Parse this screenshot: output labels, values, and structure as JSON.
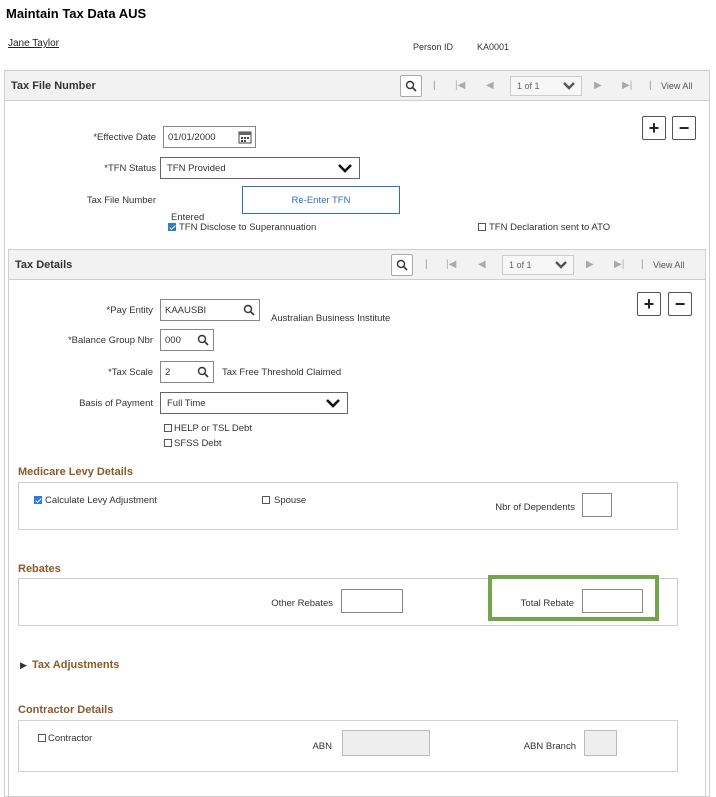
{
  "page": {
    "title": "Maintain Tax Data AUS",
    "person_name": "Jane Taylor",
    "person_id_label": "Person ID",
    "person_id_value": "KA0001"
  },
  "tfn_section": {
    "header": "Tax File Number",
    "pager": "1 of 1",
    "view_all": "View All",
    "effective_date_label": "*Effective Date",
    "effective_date_value": "01/01/2000",
    "tfn_status_label": "*TFN Status",
    "tfn_status_value": "TFN Provided",
    "tax_file_number_label": "Tax File Number",
    "reenter_button": "Re-Enter TFN",
    "entered_label": "Entered",
    "disclose_label": "TFN Disclose to Superannuation",
    "declaration_label": "TFN Declaration sent to ATO"
  },
  "tax_details": {
    "header": "Tax Details",
    "pager": "1 of 1",
    "view_all": "View All",
    "pay_entity_label": "*Pay Entity",
    "pay_entity_value": "KAAUSBI",
    "pay_entity_desc": "Australian Business Institute",
    "balance_group_label": "*Balance Group Nbr",
    "balance_group_value": "000",
    "tax_scale_label": "*Tax Scale",
    "tax_scale_value": "2",
    "tax_scale_desc": "Tax Free Threshold Claimed",
    "basis_label": "Basis of Payment",
    "basis_value": "Full Time",
    "help_debt_label": "HELP or TSL Debt",
    "sfss_debt_label": "SFSS Debt"
  },
  "medicare": {
    "title": "Medicare Levy Details",
    "calc_levy_label": "Calculate Levy Adjustment",
    "spouse_label": "Spouse",
    "dependents_label": "Nbr of Dependents"
  },
  "rebates": {
    "title": "Rebates",
    "other_label": "Other Rebates",
    "total_label": "Total Rebate"
  },
  "tax_adjustments": {
    "title": "Tax Adjustments"
  },
  "contractor": {
    "title": "Contractor Details",
    "contractor_label": "Contractor",
    "abn_label": "ABN",
    "abn_branch_label": "ABN Branch"
  },
  "colors": {
    "group_title": "#8a5a2b",
    "highlight": "#73a64a",
    "link_blue": "#2e6fbf",
    "checkbox_blue": "#2c7bd6"
  }
}
